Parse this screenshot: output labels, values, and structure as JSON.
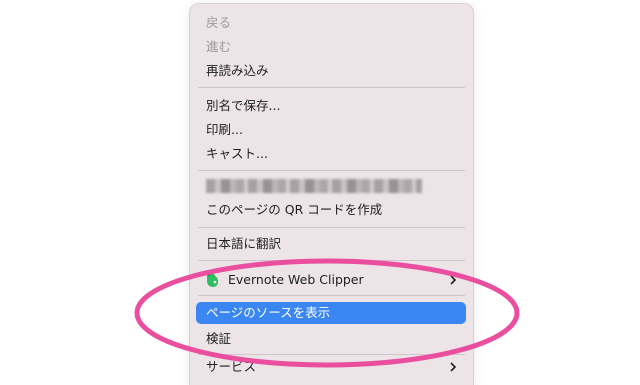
{
  "menu": {
    "back": "戻る",
    "forward": "進む",
    "reload": "再読み込み",
    "save_as": "別名で保存...",
    "print": "印刷...",
    "cast": "キャスト...",
    "qr": "このページの QR コードを作成",
    "translate": "日本語に翻訳",
    "evernote": "Evernote Web Clipper",
    "view_source": "ページのソースを表示",
    "inspect": "検証",
    "services": "サービス"
  },
  "colors": {
    "highlight": "#3a86f3",
    "annotation": "#ea4f9f",
    "evernote_green": "#2dbe60"
  }
}
